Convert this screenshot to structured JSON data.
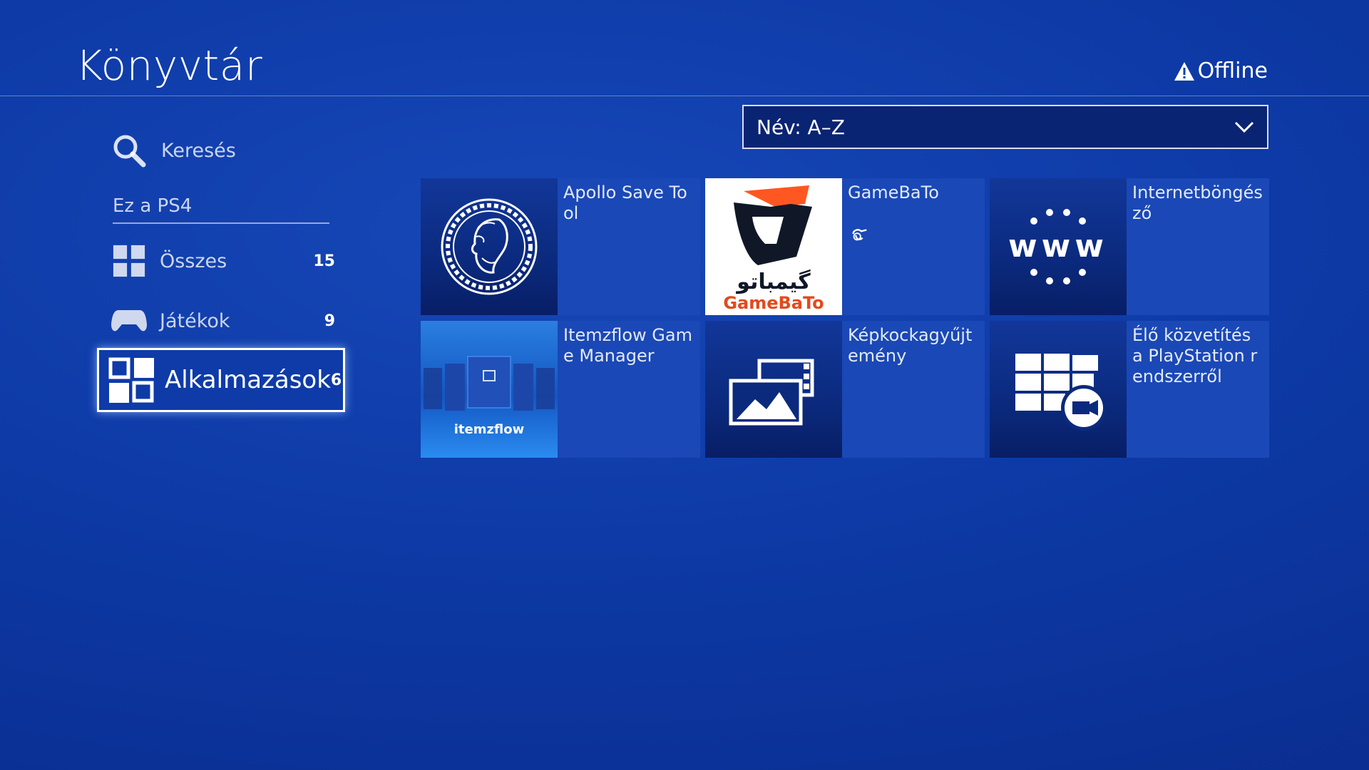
{
  "header": {
    "title": "Könyvtár",
    "status": "Offline"
  },
  "sidebar": {
    "search_label": "Keresés",
    "section_label": "Ez a PS4",
    "items": [
      {
        "label": "Összes",
        "count": "15",
        "icon": "grid-icon"
      },
      {
        "label": "Játékok",
        "count": "9",
        "icon": "gamepad-icon"
      },
      {
        "label": "Alkalmazások",
        "count": "6",
        "icon": "apps-icon",
        "selected": true
      }
    ]
  },
  "sort": {
    "value": "Név: A–Z"
  },
  "apps": [
    {
      "name": "Apollo Save Tool",
      "icon": "apollo-medallion-icon"
    },
    {
      "name": "GameBaTo",
      "icon": "gamebato-logo",
      "logo_text": "GameBaTo",
      "logo_arabic": "گیمباتو"
    },
    {
      "name": "Internetböngésző",
      "icon": "www-browser-icon",
      "icon_text": "www"
    },
    {
      "name": "Itemzflow Game Manager",
      "icon": "itemzflow-icon",
      "icon_text": "itemzflow"
    },
    {
      "name": "Képkockagyűjtemény",
      "icon": "capture-gallery-icon"
    },
    {
      "name": "Élő közvetítés a PlayStation rendszerről",
      "icon": "remote-play-icon"
    }
  ],
  "colors": {
    "background": "#0d3aa6",
    "tile": "#1a48b6",
    "selected_border": "#ffffff"
  }
}
